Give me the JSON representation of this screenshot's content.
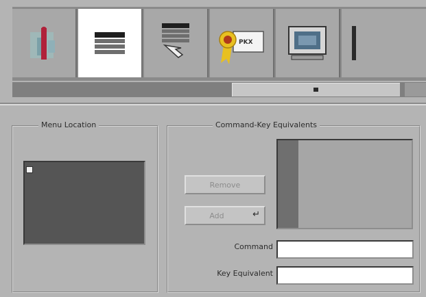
{
  "toolbar": {
    "buttons": [
      {
        "icon": "info-icon",
        "selected": false
      },
      {
        "icon": "menu-icon",
        "selected": true
      },
      {
        "icon": "menu-select-icon",
        "selected": false
      },
      {
        "icon": "certificate-icon",
        "selected": false
      },
      {
        "icon": "monitor-icon",
        "selected": false
      },
      {
        "icon": "partial-icon",
        "selected": false
      }
    ]
  },
  "menu_location": {
    "title": "Menu Location"
  },
  "command_keys": {
    "title": "Command-Key Equivalents",
    "remove_label": "Remove",
    "add_label": "Add",
    "command_label": "Command",
    "key_equivalent_label": "Key Equivalent",
    "command_value": "",
    "key_equivalent_value": ""
  },
  "colors": {
    "window_bg": "#b4b4b4",
    "selected_tab": "#ffffff",
    "well_dark": "#555555"
  }
}
